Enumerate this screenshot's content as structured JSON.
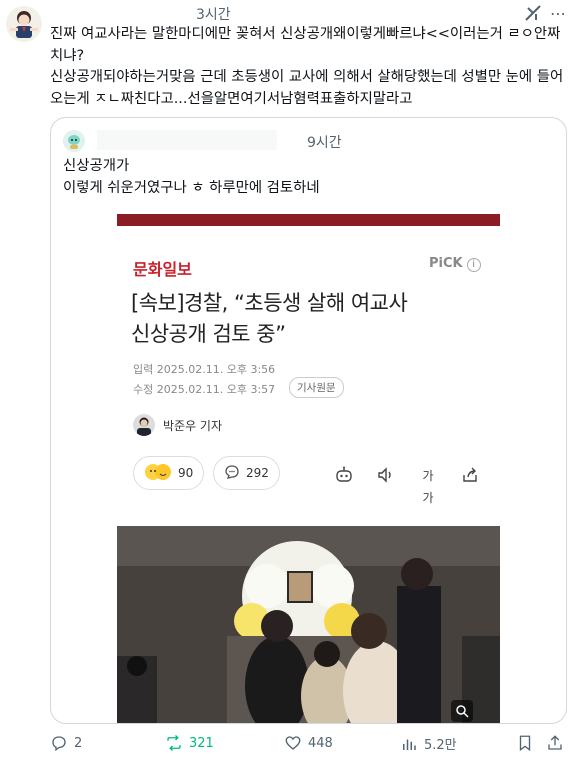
{
  "tweet": {
    "time": "3시간",
    "text_lines": [
      "진짜 여교사라는 말한마디에만 꽂혀서 신상공개왜이렇게빠르냐<<이러는거 ㄹㅇ안짜치냐?",
      "신상공개되야하는거맞음 근데 초등생이 교사에 의해서 살해당했는데 성별만 눈에 들어오는게 ㅈㄴ짜친다고...선을알면여기서남혐력표출하지말라고"
    ]
  },
  "quote": {
    "time": "9시간",
    "line1": "신상공개가",
    "line2": "이렇게 쉬운거였구나 ㅎ 하루만에 검토하네"
  },
  "article": {
    "brand": "문화일보",
    "pick": "PiCK",
    "pick_info": "i",
    "headline_line1": "[속보]경찰, “초등생 살해 여교사",
    "headline_line2": "신상공개 검토 중”",
    "input_date": "입력 2025.02.11. 오후 3:56",
    "edit_date": "수정 2025.02.11. 오후 3:57",
    "original_button": "기사원문",
    "reporter": "박준우 기자",
    "reactions_count": "90",
    "comments_count": "292",
    "text_size_label": "가가"
  },
  "actions": {
    "replies": "2",
    "reposts": "321",
    "likes": "448",
    "views": "5.2만"
  },
  "colors": {
    "text": "#0f1419",
    "secondary": "#536471",
    "repost_active": "#00ba7c",
    "brand_red": "#c8222c",
    "border": "#cfd9de"
  },
  "icons": [
    "reply-icon",
    "repost-icon",
    "like-icon",
    "views-icon",
    "bookmark-icon",
    "share-icon",
    "grok-icon",
    "more-icon"
  ]
}
